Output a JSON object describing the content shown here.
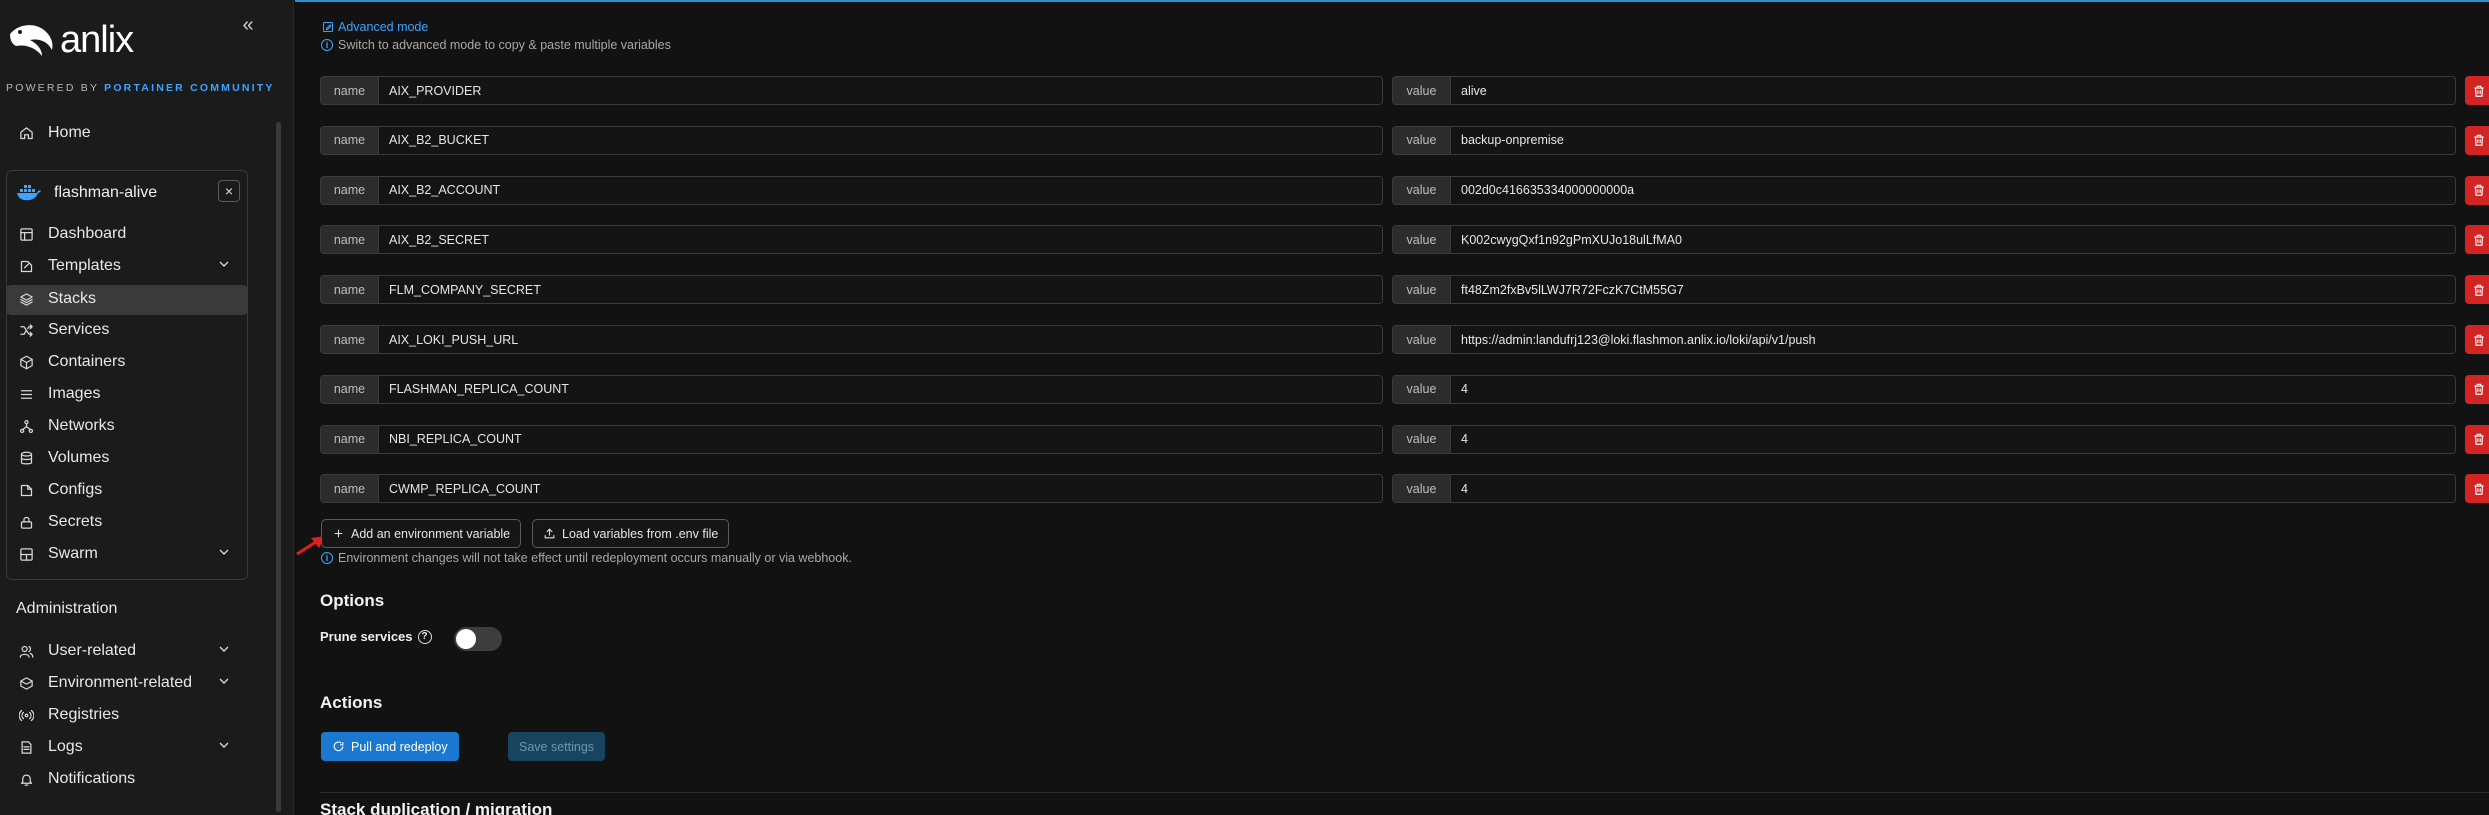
{
  "brand": {
    "logo_text": "anlix",
    "powered_by_prefix": "POWERED BY ",
    "powered_by_brand": "PORTAINER COMMUNITY",
    "collapse_icon": "«"
  },
  "sidebar": {
    "home": "Home",
    "environment": {
      "name": "flashman-alive",
      "close": "×"
    },
    "env_items": [
      {
        "label": "Dashboard",
        "icon": "dashboard-icon"
      },
      {
        "label": "Templates",
        "icon": "templates-icon",
        "expandable": true
      },
      {
        "label": "Stacks",
        "icon": "stacks-icon",
        "active": true
      },
      {
        "label": "Services",
        "icon": "services-icon"
      },
      {
        "label": "Containers",
        "icon": "containers-icon"
      },
      {
        "label": "Images",
        "icon": "images-icon"
      },
      {
        "label": "Networks",
        "icon": "networks-icon"
      },
      {
        "label": "Volumes",
        "icon": "volumes-icon"
      },
      {
        "label": "Configs",
        "icon": "configs-icon"
      },
      {
        "label": "Secrets",
        "icon": "secrets-icon"
      },
      {
        "label": "Swarm",
        "icon": "swarm-icon",
        "expandable": true
      }
    ],
    "admin_title": "Administration",
    "admin_items": [
      {
        "label": "User-related",
        "icon": "users-icon",
        "expandable": true
      },
      {
        "label": "Environment-related",
        "icon": "environment-icon",
        "expandable": true
      },
      {
        "label": "Registries",
        "icon": "registries-icon"
      },
      {
        "label": "Logs",
        "icon": "logs-icon",
        "expandable": true
      },
      {
        "label": "Notifications",
        "icon": "bell-icon"
      }
    ]
  },
  "env_vars": {
    "advanced_mode_link": "Advanced mode",
    "advanced_mode_help": "Switch to advanced mode to copy & paste multiple variables",
    "name_addon": "name",
    "value_addon": "value",
    "rows": [
      {
        "name": "AIX_PROVIDER",
        "value": "alive"
      },
      {
        "name": "AIX_B2_BUCKET",
        "value": "backup-onpremise"
      },
      {
        "name": "AIX_B2_ACCOUNT",
        "value": "002d0c416635334000000000a"
      },
      {
        "name": "AIX_B2_SECRET",
        "value": "K002cwygQxf1n92gPmXUJo18ulLfMA0"
      },
      {
        "name": "FLM_COMPANY_SECRET",
        "value": "ft48Zm2fxBv5lLWJ7R72FczK7CtM55G7"
      },
      {
        "name": "AIX_LOKI_PUSH_URL",
        "value": "https://admin:landufrj123@loki.flashmon.anlix.io/loki/api/v1/push"
      },
      {
        "name": "FLASHMAN_REPLICA_COUNT",
        "value": "4"
      },
      {
        "name": "NBI_REPLICA_COUNT",
        "value": "4"
      },
      {
        "name": "CWMP_REPLICA_COUNT",
        "value": "4"
      }
    ],
    "add_button": "Add an environment variable",
    "load_button": "Load variables from .env file",
    "redeploy_help": "Environment changes will not take effect until redeployment occurs manually or via webhook."
  },
  "options": {
    "title": "Options",
    "prune_label": "Prune services",
    "prune_help_icon": "?",
    "prune_enabled": false
  },
  "actions": {
    "title": "Actions",
    "pull_redeploy": "Pull and redeploy",
    "save_settings": "Save settings"
  },
  "duplication": {
    "title": "Stack duplication / migration"
  },
  "colors": {
    "accent": "#1b78d0",
    "link": "#3ea3ff",
    "danger": "#d32424",
    "sidebar_bg": "#1b1b1b",
    "main_bg": "#121212"
  }
}
